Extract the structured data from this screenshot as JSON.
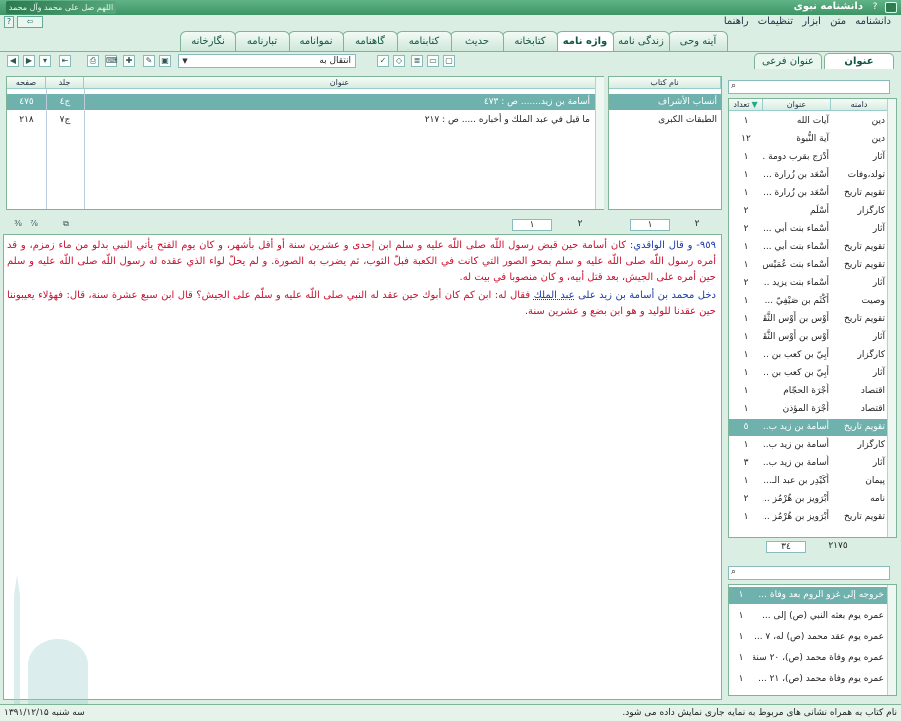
{
  "window": {
    "title": "دانشنامه نبوی",
    "caption": "اللهم صل علی محمد وآل محمد"
  },
  "menu": [
    "دانشنامه",
    "متن",
    "ابزار",
    "تنظیمات",
    "راهنما"
  ],
  "tabs": [
    "آینه وحی",
    "زندگی نامه",
    "واژه نامه",
    "کتابخانه",
    "حدیث",
    "کتابنامه",
    "گاهنامه",
    "نموانامه",
    "تبارنامه",
    "نگارخانه"
  ],
  "active_tab": "واژه نامه",
  "subtabs": [
    "عنوان",
    "عنوان فرعی"
  ],
  "nav_select": "انتقال به",
  "books": {
    "header": "نام کتاب",
    "rows": [
      "أنساب الأشراف",
      "الطبقات الكبرى"
    ]
  },
  "results": {
    "headers": {
      "title": "عنوان",
      "volume": "جلد",
      "page": "صفحه"
    },
    "rows": [
      {
        "title": "أسامة بن زيد....... ص : ٤٧٣",
        "volume": "ج٤",
        "page": "٤٧٥"
      },
      {
        "title": "ما قيل في عبد الملك و أخباره ..... ص : ٢١٧",
        "volume": "ج٧",
        "page": "٢١٨"
      }
    ],
    "pager_left": {
      "current": "١",
      "total": "٢"
    },
    "pager_right": {
      "current": "١",
      "total": "٢"
    }
  },
  "article": {
    "p1_num": "٩٥٩- و قال الواقدي:",
    "p1_text": "كان أسامة حين قبض رسول اللّه صلى اللّه عليه و سلم ابن إحدى و عشرين سنة أو أقل بأشهر، و كان يوم الفتح يأتي النبي بدلو من ماء زمزم، و قد أمره رسول اللّه صلى اللّه عليه و سلم بمحو الصور التي كانت في الكعبة فبلّ الثوب، ثم يضرب به الصورة. و لم يحلّ لواء الذي عقده له رسول اللّه صلى اللّه عليه و سلم حين أمره على الجيش، بعد قتل أبيه، و كان منصوبا في بيت له.",
    "p2_a": "دخل محمد بن أسامة بن زيد على",
    "p2_b": "عبد الملك",
    "p2_c": "فقال له: ابن كم كان أبوك حين عقد له النبي صلى اللّه عليه و سلّم على الجيش؟ قال ابن سبع عشرة سنة، قال: فهؤلاء يعيبوننا حين عقدنا للوليد و هو ابن بضع و عشرين سنة."
  },
  "terms": {
    "headers": {
      "domain": "دامنه",
      "title": "عنوان",
      "count": "تعداد"
    },
    "rows": [
      {
        "domain": "دین",
        "title": "آيات الله",
        "count": "١"
      },
      {
        "domain": "دین",
        "title": "آية النُّبوة",
        "count": "١٢"
      },
      {
        "domain": "آثار",
        "title": "أَدْرَج بقرب دومة ...",
        "count": "١"
      },
      {
        "domain": "تولد،وفات",
        "title": "أَسْعَد بن زُرارة ...",
        "count": "١"
      },
      {
        "domain": "تقويم تاريخ",
        "title": "أَسْعَد بن زُرارة ...",
        "count": "١"
      },
      {
        "domain": "كارگزار",
        "title": "أَسْلَم",
        "count": "٢"
      },
      {
        "domain": "آثار",
        "title": "أَسْماء بنت أبي ...",
        "count": "٢"
      },
      {
        "domain": "تقويم تاريخ",
        "title": "أَسْماء بنت أبي ...",
        "count": "١"
      },
      {
        "domain": "تقويم تاريخ",
        "title": "أَسْماء بنت عُمَيْس ...",
        "count": "١"
      },
      {
        "domain": "آثار",
        "title": "أَسْماء بنت يزيد ...",
        "count": "٢"
      },
      {
        "domain": "وصيت",
        "title": "أَكْثَم بن صَيْفِيّ ...",
        "count": "١"
      },
      {
        "domain": "تقويم تاريخ",
        "title": "أَوْس بن أَوْس الثَّقَفي",
        "count": "١"
      },
      {
        "domain": "آثار",
        "title": "أَوْس بن أَوْس الثَّقَفي",
        "count": "١"
      },
      {
        "domain": "كارگزار",
        "title": "أَبِيّ بن كعب بن ...",
        "count": "١"
      },
      {
        "domain": "آثار",
        "title": "أَبِيّ بن كعب بن ...",
        "count": "١"
      },
      {
        "domain": "اقتصاد",
        "title": "أُجْرَة الحجّام",
        "count": "١"
      },
      {
        "domain": "اقتصاد",
        "title": "أُجْرَة المؤذن",
        "count": "١"
      },
      {
        "domain": "تقويم تاريخ",
        "title": "أُسامة بن زيد ب...",
        "count": "٥"
      },
      {
        "domain": "كارگزار",
        "title": "أُسامة بن زيد ب...",
        "count": "١"
      },
      {
        "domain": "آثار",
        "title": "أُسامة بن زيد ب...",
        "count": "٣"
      },
      {
        "domain": "پيمان",
        "title": "أُكَيْدِر بن عبد الـ...",
        "count": "١"
      },
      {
        "domain": "نامه",
        "title": "أَبْرَويز بن هُرْمُز ...",
        "count": "٢"
      },
      {
        "domain": "تقويم تاريخ",
        "title": "أَبْرَويز بن هُرْمُز ...",
        "count": "١"
      }
    ],
    "selected_index": 17,
    "pager": {
      "current": "٣٤",
      "total": "٢١٧٥"
    }
  },
  "subterms": {
    "rows": [
      {
        "title": "خروجه إلى غزو الروم بعد وفاة ...",
        "count": "١"
      },
      {
        "title": "عمره يوم بعثه النبي (ص) إلى ...",
        "count": "١"
      },
      {
        "title": "عمره يوم عقد محمد (ص) له، ٧ ...",
        "count": "١"
      },
      {
        "title": "عمره يوم وفاة محمد (ص)، ٢٠ سنة",
        "count": "١"
      },
      {
        "title": "عمره يوم وفاة محمد (ص)، ٢١ ...",
        "count": "١"
      }
    ]
  },
  "status": {
    "message": "نام کتاب به همراه نشانی های مربوط به نمایه جاری نمایش داده می شود.",
    "date": "سه شنبه ۱۳۹۱/۱۲/۱۵"
  },
  "colors": {
    "accent": "#6fb1ad",
    "border": "#7fb496",
    "red": "#c8102e",
    "blue": "#1a3aa8"
  }
}
